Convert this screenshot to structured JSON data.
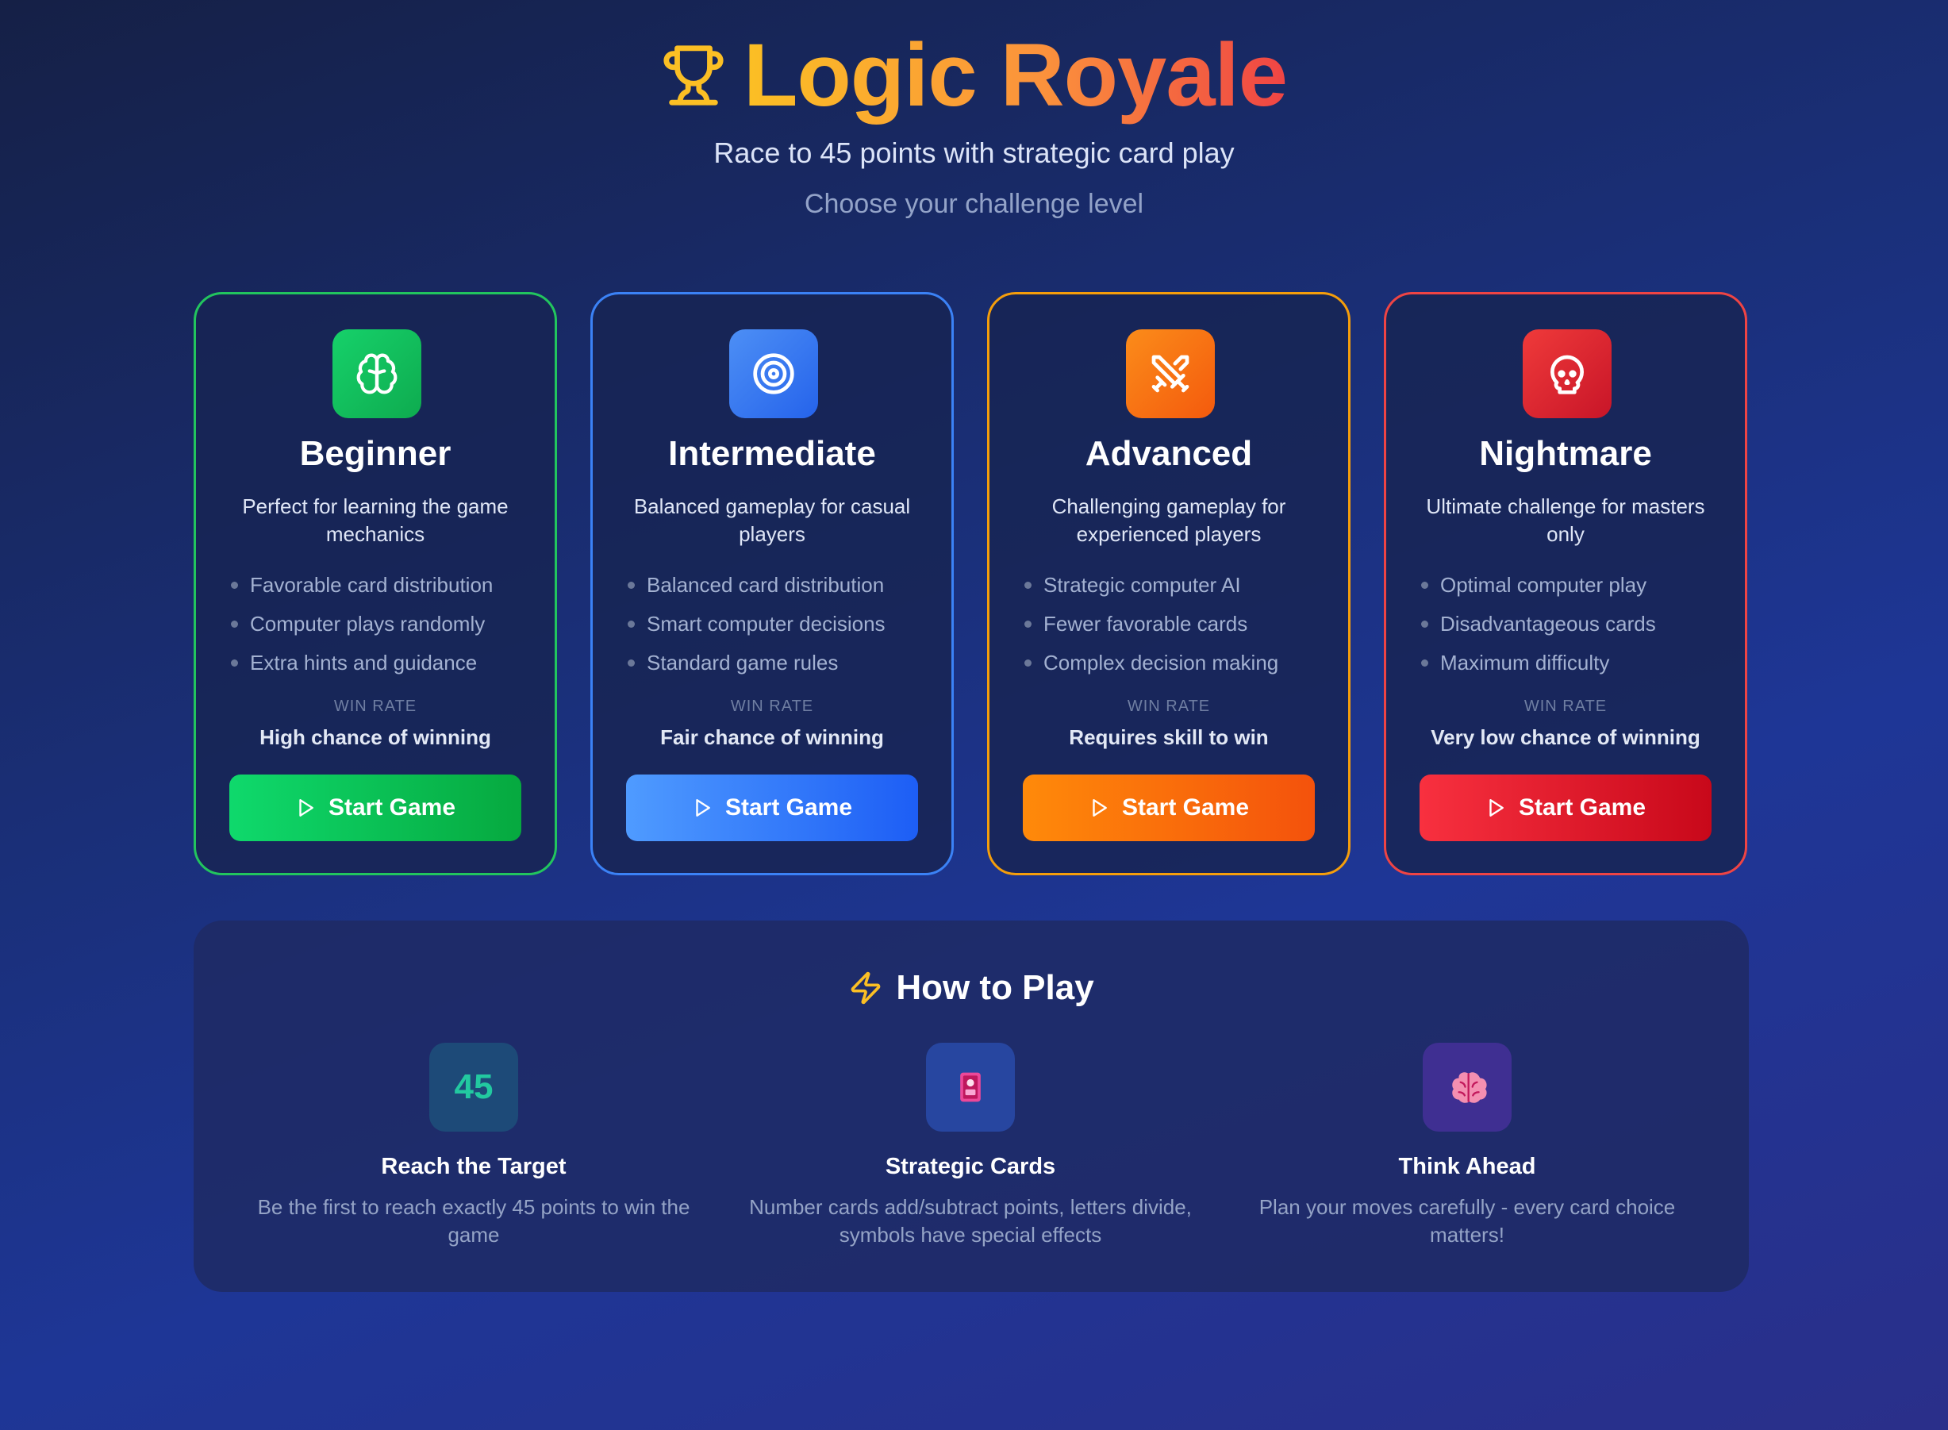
{
  "header": {
    "icon": "trophy-icon",
    "title": "Logic Royale",
    "subtitle": "Race to 45 points with strategic card play",
    "tagline": "Choose your challenge level"
  },
  "colors": {
    "title_gradient": [
      "#fbbf24",
      "#fb923c",
      "#ef4444"
    ],
    "beginner": "#22c55e",
    "intermediate": "#3b82f6",
    "advanced": "#f59e0b",
    "nightmare": "#ef4444"
  },
  "levels": [
    {
      "icon": "brain-icon",
      "title": "Beginner",
      "description": "Perfect for learning the game mechanics",
      "features": [
        "Favorable card distribution",
        "Computer plays randomly",
        "Extra hints and guidance"
      ],
      "win_rate_label": "WIN RATE",
      "win_rate": "High chance of winning",
      "button": "Start Game"
    },
    {
      "icon": "target-icon",
      "title": "Intermediate",
      "description": "Balanced gameplay for casual players",
      "features": [
        "Balanced card distribution",
        "Smart computer decisions",
        "Standard game rules"
      ],
      "win_rate_label": "WIN RATE",
      "win_rate": "Fair chance of winning",
      "button": "Start Game"
    },
    {
      "icon": "swords-icon",
      "title": "Advanced",
      "description": "Challenging gameplay for experienced players",
      "features": [
        "Strategic computer AI",
        "Fewer favorable cards",
        "Complex decision making"
      ],
      "win_rate_label": "WIN RATE",
      "win_rate": "Requires skill to win",
      "button": "Start Game"
    },
    {
      "icon": "skull-icon",
      "title": "Nightmare",
      "description": "Ultimate challenge for masters only",
      "features": [
        "Optimal computer play",
        "Disadvantageous cards",
        "Maximum difficulty"
      ],
      "win_rate_label": "WIN RATE",
      "win_rate": "Very low chance of winning",
      "button": "Start Game"
    }
  ],
  "how_to_play": {
    "icon": "lightning-icon",
    "title": "How to Play",
    "steps": [
      {
        "icon_text": "45",
        "title": "Reach the Target",
        "description": "Be the first to reach exactly 45 points to win the game"
      },
      {
        "icon": "card-icon",
        "title": "Strategic Cards",
        "description": "Number cards add/subtract points, letters divide, symbols have special effects"
      },
      {
        "icon": "brain-emoji-icon",
        "title": "Think Ahead",
        "description": "Plan your moves carefully - every card choice matters!"
      }
    ]
  }
}
